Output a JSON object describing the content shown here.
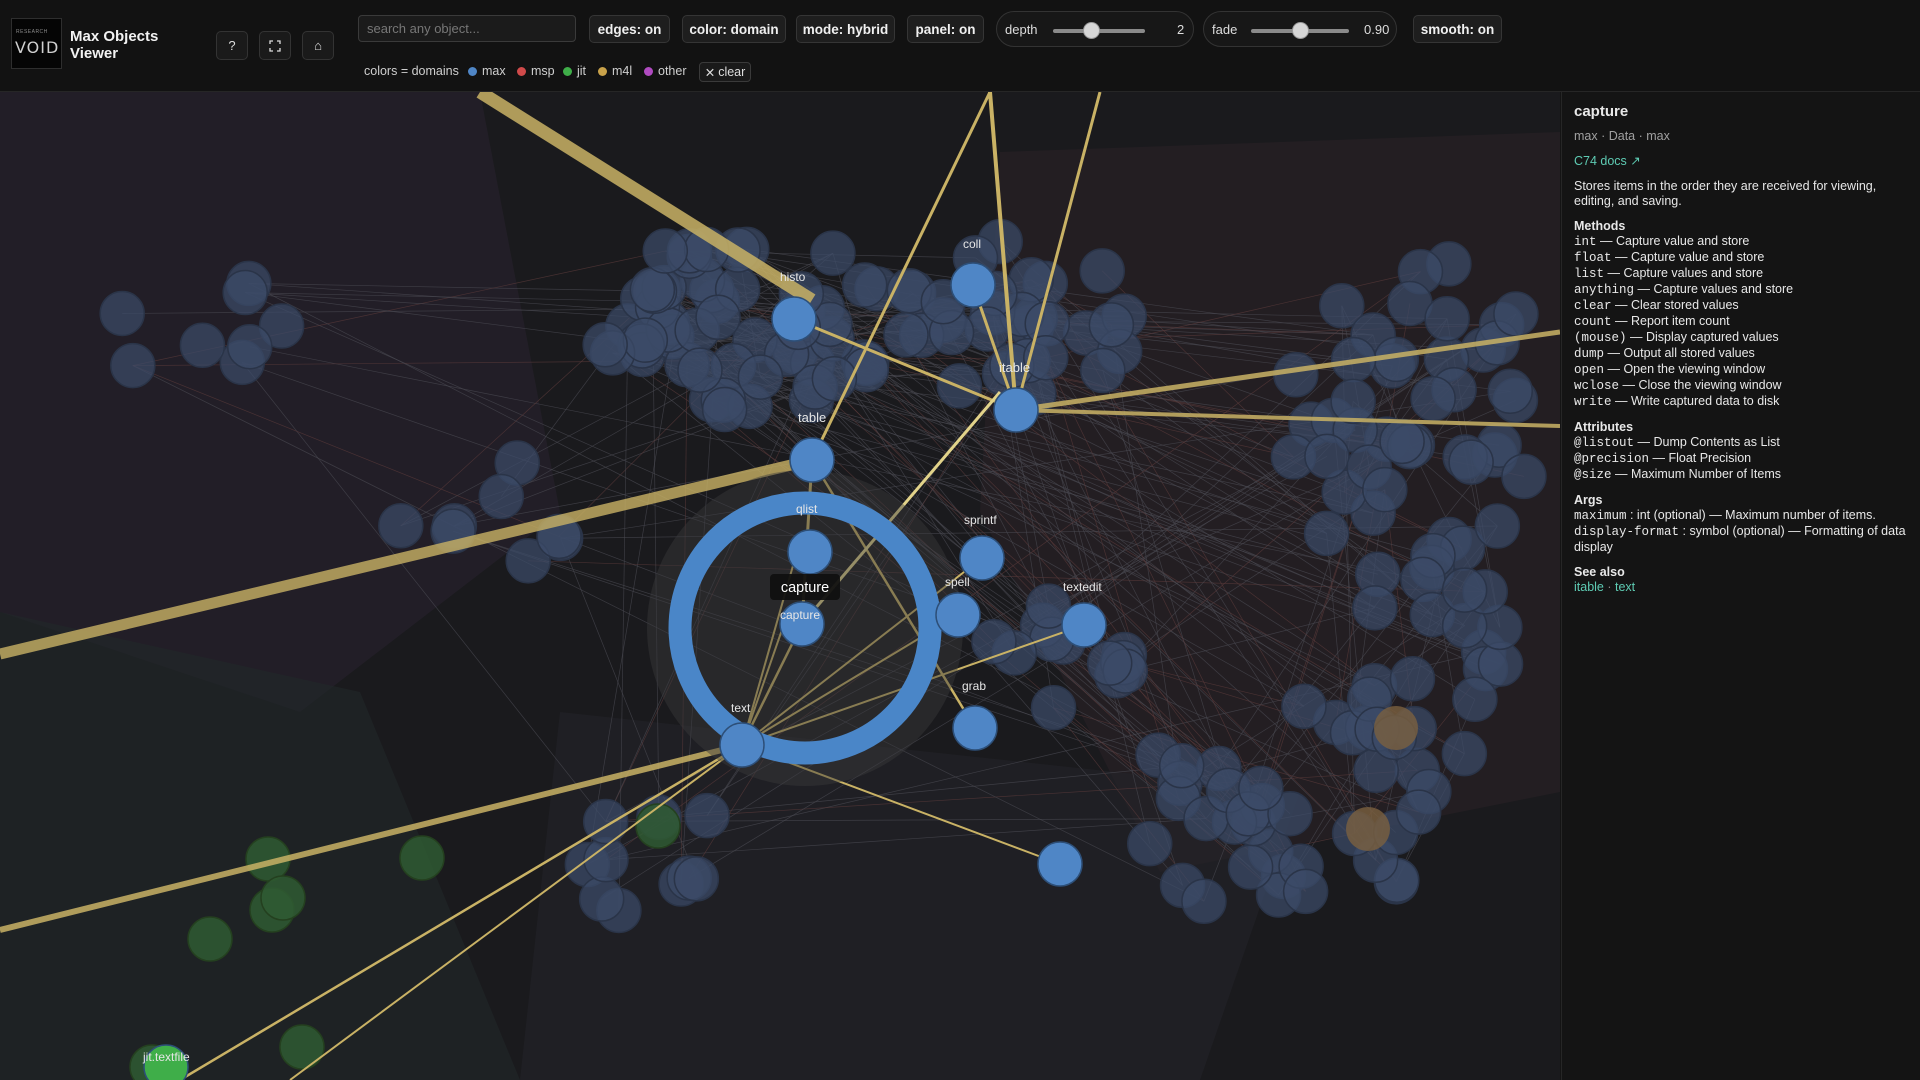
{
  "header": {
    "logo_small": "RESEARCH",
    "logo_main": "VOID",
    "title": "Max Objects Viewer",
    "help_icon": "question-icon",
    "fullscreen_icon": "fullscreen-icon",
    "home_icon": "home-icon"
  },
  "toolbar": {
    "search_placeholder": "search any object...",
    "edges": "edges: on",
    "color": "color: domain",
    "mode": "mode: hybrid",
    "panel": "panel: on",
    "depth_label": "depth",
    "depth_value": "2",
    "fade_label": "fade",
    "fade_value": "0.90",
    "smooth": "smooth: on"
  },
  "legend": {
    "prefix": "colors = domains",
    "items": [
      {
        "label": "max",
        "color": "#4f86c6"
      },
      {
        "label": "msp",
        "color": "#d04a4a"
      },
      {
        "label": "jit",
        "color": "#3fae49"
      },
      {
        "label": "m4l",
        "color": "#c9a24a"
      },
      {
        "label": "other",
        "color": "#b04bc0"
      }
    ],
    "clear": "clear"
  },
  "graph": {
    "colors": {
      "node_max": "#4f86c6",
      "edge_highlight": "#c9b265",
      "ring": "#4a86c8"
    },
    "focus_label": "capture",
    "labels": [
      "histo",
      "coll",
      "itable",
      "table",
      "qlist",
      "sprintf",
      "spell",
      "textedit",
      "capture",
      "grab",
      "text",
      "jit.textfile"
    ]
  },
  "panel": {
    "title": "capture",
    "subtitle": "max · Data · max",
    "docs": "C74 docs ↗",
    "description": "Stores items in the order they are received for viewing, editing, and saving.",
    "methods_title": "Methods",
    "methods": [
      {
        "name": "int",
        "desc": " — Capture value and store"
      },
      {
        "name": "float",
        "desc": " — Capture value and store"
      },
      {
        "name": "list",
        "desc": " — Capture values and store"
      },
      {
        "name": "anything",
        "desc": " — Capture values and store"
      },
      {
        "name": "clear",
        "desc": " — Clear stored values"
      },
      {
        "name": "count",
        "desc": " — Report item count"
      },
      {
        "name": "(mouse)",
        "desc": " — Display captured values"
      },
      {
        "name": "dump",
        "desc": " — Output all stored values"
      },
      {
        "name": "open",
        "desc": " — Open the viewing window"
      },
      {
        "name": "wclose",
        "desc": " — Close the viewing window"
      },
      {
        "name": "write",
        "desc": " — Write captured data to disk"
      }
    ],
    "attributes_title": "Attributes",
    "attributes": [
      {
        "name": "@listout",
        "desc": " — Dump Contents as List"
      },
      {
        "name": "@precision",
        "desc": " — Float Precision"
      },
      {
        "name": "@size",
        "desc": " — Maximum Number of Items"
      }
    ],
    "args_title": "Args",
    "args": [
      {
        "name": "maximum",
        "desc": " : int (optional) — Maximum number of items."
      },
      {
        "name": "display-format",
        "desc": " : symbol (optional) — Formatting of data display"
      }
    ],
    "see_also_title": "See also",
    "see_also": [
      "itable",
      "text"
    ],
    "see_sep": " · "
  }
}
